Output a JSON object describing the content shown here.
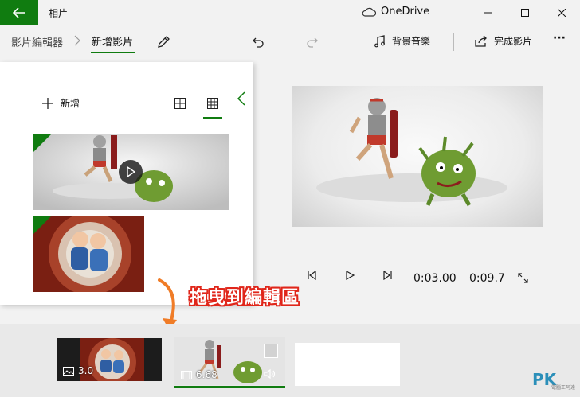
{
  "window": {
    "app_title": "相片",
    "onedrive_label": "OneDrive"
  },
  "toolbar": {
    "breadcrumb_parent": "影片編輯器",
    "breadcrumb_current": "新增影片",
    "background_music_label": "背景音樂",
    "finish_video_label": "完成影片",
    "more_label": "···"
  },
  "library": {
    "add_label": "新增"
  },
  "playback": {
    "current_time": "0:03.00",
    "total_time": "0:09.7"
  },
  "annotation": {
    "text": "拖曳到編輯區"
  },
  "storyboard": {
    "clips": [
      {
        "duration": "3.0",
        "type_icon": "image-icon"
      },
      {
        "duration": "6.68",
        "type_icon": "video-icon"
      }
    ]
  },
  "watermark": {
    "logo": "PK",
    "tagline": "電腦王阿達"
  },
  "colors": {
    "accent": "#107c10",
    "annotation_outline": "#e0261a",
    "arrow": "#f07c27"
  }
}
